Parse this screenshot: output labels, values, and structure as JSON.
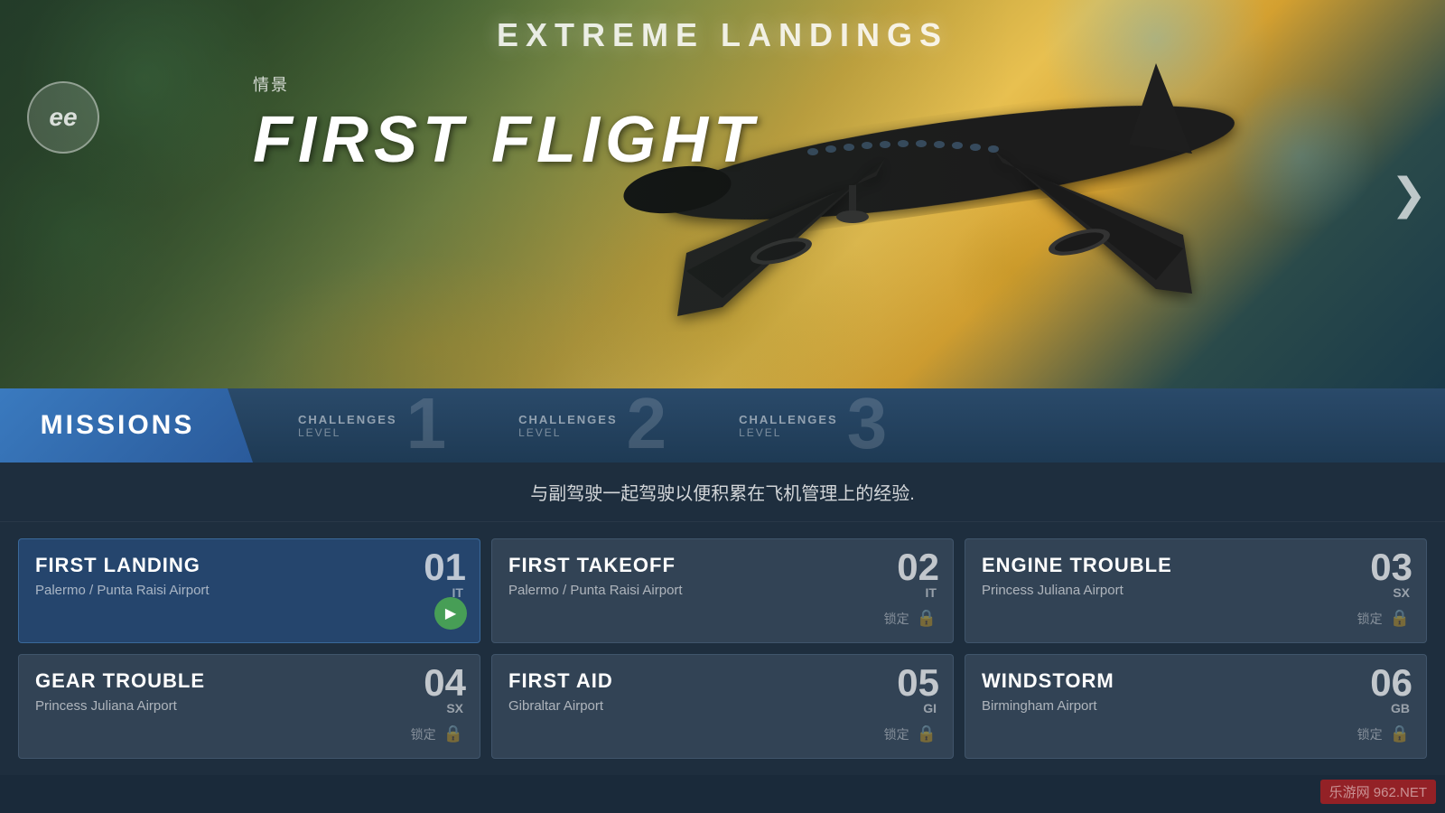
{
  "game": {
    "title": "EXTREME LANDINGS",
    "logo_text": "ee"
  },
  "hero": {
    "subtitle": "情景",
    "title": "FIRST FLIGHT",
    "next_arrow": "❯"
  },
  "tabs": {
    "missions_label": "MISSIONS",
    "challenges": [
      {
        "id": "tab-c1",
        "label": "CHALLENGES",
        "level": "LEVEL",
        "number": "1"
      },
      {
        "id": "tab-c2",
        "label": "CHALLENGES",
        "level": "LEVEL",
        "number": "2"
      },
      {
        "id": "tab-c3",
        "label": "CHALLENGES",
        "level": "LEVEL",
        "number": "3"
      }
    ]
  },
  "description": "与副驾驶一起驾驶以便积累在飞机管理上的经验.",
  "missions": [
    {
      "id": "m01",
      "name": "FIRST LANDING",
      "number": "01",
      "airport": "Palermo / Punta Raisi Airport",
      "country": "IT",
      "locked": false,
      "active": true
    },
    {
      "id": "m02",
      "name": "FIRST TAKEOFF",
      "number": "02",
      "airport": "Palermo / Punta Raisi Airport",
      "country": "IT",
      "locked": true,
      "lock_text": "锁定"
    },
    {
      "id": "m03",
      "name": "ENGINE TROUBLE",
      "number": "03",
      "airport": "Princess Juliana Airport",
      "country": "SX",
      "locked": true,
      "lock_text": "锁定"
    },
    {
      "id": "m04",
      "name": "GEAR TROUBLE",
      "number": "04",
      "airport": "Princess Juliana Airport",
      "country": "SX",
      "locked": true,
      "lock_text": "锁定"
    },
    {
      "id": "m05",
      "name": "FIRST AID",
      "number": "05",
      "airport": "Gibraltar Airport",
      "country": "GI",
      "locked": true,
      "lock_text": "锁定"
    },
    {
      "id": "m06",
      "name": "WINDSTORM",
      "number": "06",
      "airport": "Birmingham Airport",
      "country": "GB",
      "locked": true,
      "lock_text": "锁定"
    }
  ],
  "watermark": {
    "site": "乐游网",
    "url": "962.NET"
  }
}
